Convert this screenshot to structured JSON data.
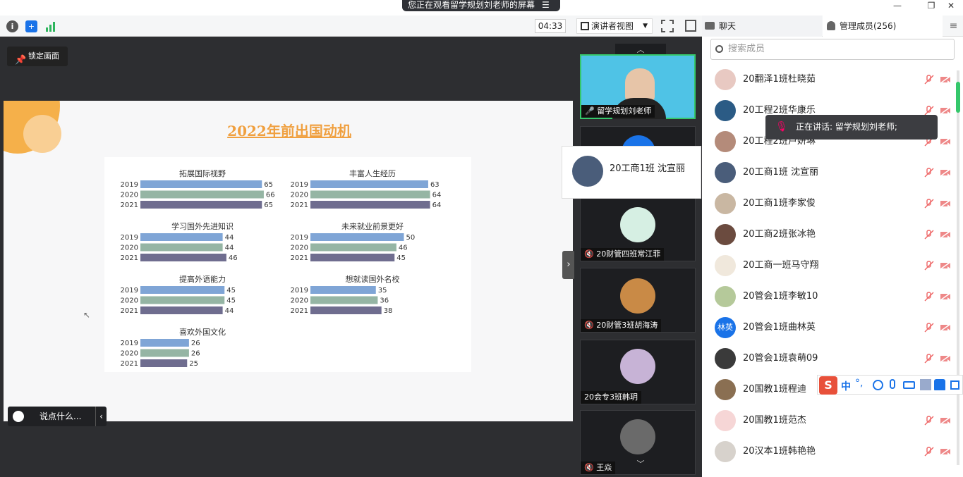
{
  "share_banner": "您正在观看留学规划刘老师的屏幕",
  "toolbar": {
    "timer": "04:33",
    "speaker_view": "演讲者视图",
    "tab_chat": "聊天",
    "tab_members": "管理成员(256)"
  },
  "main": {
    "lock_label": "锁定画面",
    "comment_placeholder": "说点什么...",
    "slide_title": "2022年前出国动机"
  },
  "chart_data": {
    "type": "bar",
    "categories": [
      "2019",
      "2020",
      "2021"
    ],
    "colors": [
      "#7fa5d6",
      "#95b5a4",
      "#6f6d8f"
    ],
    "groups": [
      {
        "title": "拓展国际视野",
        "values": [
          65,
          66,
          65
        ]
      },
      {
        "title": "丰富人生经历",
        "values": [
          63,
          64,
          64
        ]
      },
      {
        "title": "学习国外先进知识",
        "values": [
          44,
          44,
          46
        ]
      },
      {
        "title": "未来就业前景更好",
        "values": [
          50,
          46,
          45
        ]
      },
      {
        "title": "提高外语能力",
        "values": [
          45,
          45,
          44
        ]
      },
      {
        "title": "想就读国外名校",
        "values": [
          35,
          36,
          38
        ]
      },
      {
        "title": "喜欢外国文化",
        "values": [
          26,
          26,
          25
        ]
      }
    ]
  },
  "videos": [
    {
      "label": "留学规划刘老师"
    },
    {
      "label": "20财管四班常江菲"
    },
    {
      "label": "20财管3班胡海涛"
    },
    {
      "label": "20会专3班韩玥"
    },
    {
      "label": "王焱"
    }
  ],
  "popup_name": "20工商1班 沈宣丽",
  "toast": "正在讲话: 留学规划刘老师;",
  "search_placeholder": "搜索成员",
  "members": [
    {
      "name": "20翻泽1班杜晓茹",
      "color": "#e8c9c2"
    },
    {
      "name": "20工程2班华康乐",
      "color": "#2b5b85"
    },
    {
      "name": "20工程2班卢妍琳",
      "color": "#b48b7a"
    },
    {
      "name": "20工商1班 沈宣丽",
      "color": "#4a5d7a"
    },
    {
      "name": "20工商1班李家俊",
      "color": "#c9b7a2"
    },
    {
      "name": "20工商2班张冰艳",
      "color": "#6b4b3f"
    },
    {
      "name": "20工商一班马守翔",
      "color": "#f0e8dc"
    },
    {
      "name": "20管会1班李敏10",
      "color": "#b5c99a"
    },
    {
      "name": "20管会1班曲林英",
      "color": "#1a73e8",
      "text": "林英"
    },
    {
      "name": "20管会1班袁萌09",
      "color": "#3a3a3a"
    },
    {
      "name": "20国教1班程迪",
      "color": "#8a6f52"
    },
    {
      "name": "20国教1班范杰",
      "color": "#f6d6d6"
    },
    {
      "name": "20汉本1班韩艳艳",
      "color": "#d7d2cc"
    }
  ],
  "ime": {
    "lang": "中"
  }
}
